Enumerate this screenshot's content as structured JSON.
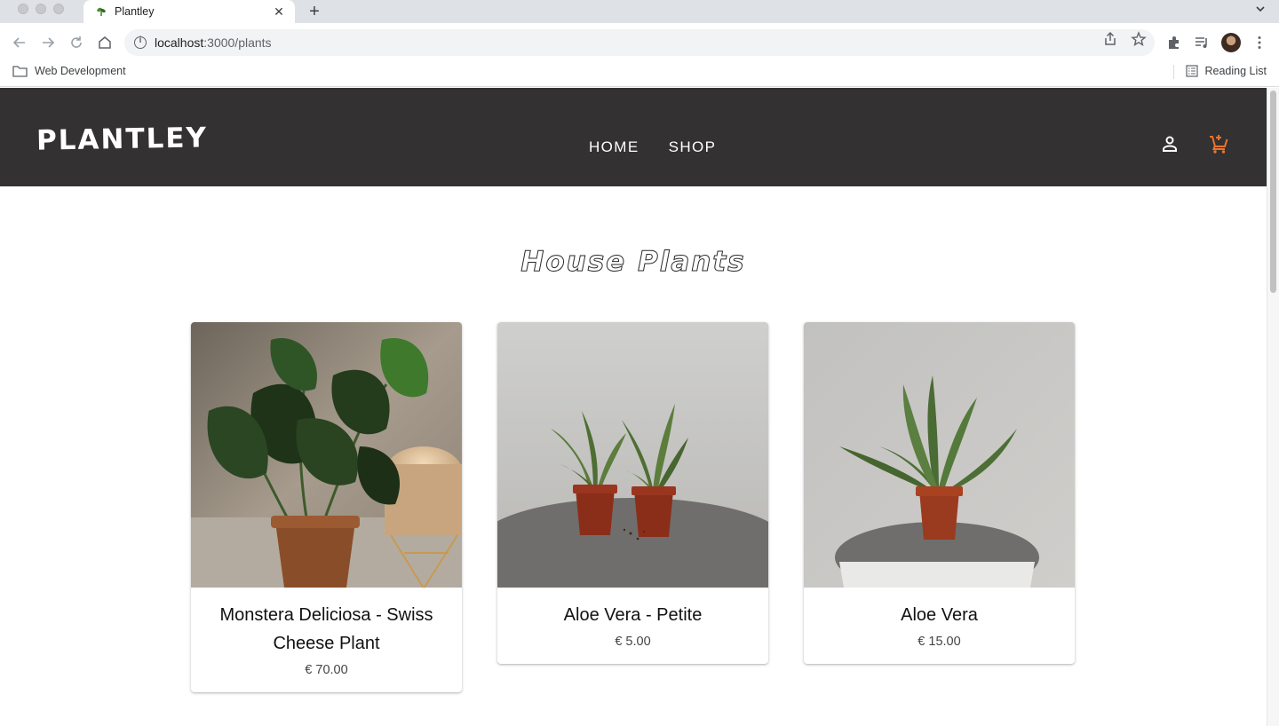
{
  "browser": {
    "tab_title": "Plantley",
    "tab_close": "✕",
    "new_tab": "+",
    "url_host": "localhost",
    "url_path": ":3000/plants",
    "bookmarks": [
      {
        "label": "Web Development"
      }
    ],
    "reading_list": "Reading List"
  },
  "site": {
    "logo": "PLANTLEY",
    "nav": [
      {
        "label": "HOME"
      },
      {
        "label": "SHOP"
      }
    ],
    "accent_color": "#e8762c",
    "header_bg": "#333132"
  },
  "main": {
    "title": "House Plants",
    "products": [
      {
        "name": "Monstera Deliciosa - Swiss Cheese Plant",
        "price": "€ 70.00"
      },
      {
        "name": "Aloe Vera - Petite",
        "price": "€ 5.00"
      },
      {
        "name": "Aloe Vera",
        "price": "€ 15.00"
      }
    ]
  }
}
